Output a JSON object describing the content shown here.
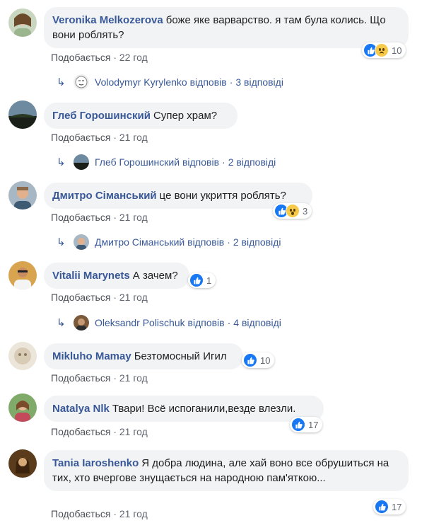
{
  "comments": [
    {
      "author": "Veronika Melkozerova",
      "text": "боже яке варварство. я там була колись. Що вони роблять?",
      "like_label": "Подобається",
      "time": "22 год",
      "reaction_count": "10",
      "reactions": [
        "like-icon",
        "sad-icon"
      ],
      "reply": {
        "author": "Volodymyr Kyrylenko",
        "verb": "відповів",
        "count": "3 відповіді"
      }
    },
    {
      "author": "Глеб Горошинский",
      "text": "Супер храм?",
      "like_label": "Подобається",
      "time": "21 год",
      "reply": {
        "author": "Глеб Горошинский",
        "verb": "відповів",
        "count": "2 відповіді"
      }
    },
    {
      "author": "Дмитро Сіманський",
      "text": "це вони укриття роблять?",
      "like_label": "Подобається",
      "time": "21 год",
      "reaction_count": "3",
      "reactions": [
        "like-icon",
        "wow-icon"
      ],
      "reply": {
        "author": "Дмитро Сіманський",
        "verb": "відповів",
        "count": "2 відповіді"
      }
    },
    {
      "author": "Vitalii Marynets",
      "text": "А зачем?",
      "like_label": "Подобається",
      "time": "21 год",
      "reaction_count": "1",
      "reactions": [
        "like-icon"
      ],
      "reply": {
        "author": "Oleksandr Polischuk",
        "verb": "відповів",
        "count": "4 відповіді"
      }
    },
    {
      "author": "Mikluho Mamay",
      "text": "Безтомосный Игил",
      "like_label": "Подобається",
      "time": "21 год",
      "reaction_count": "10",
      "reactions": [
        "like-icon"
      ]
    },
    {
      "author": "Natalya Nlk",
      "text": "Твари! Всё испоганили,везде влезли.",
      "like_label": "Подобається",
      "time": "21 год",
      "reaction_count": "17",
      "reactions": [
        "like-icon"
      ]
    },
    {
      "author": "Tania Iaroshenko",
      "text": "Я добра людина, але хай воно все обрушиться на тих, хто вчергове знущається на народною пам'яткою...",
      "like_label": "Подобається",
      "time": "21 год",
      "reaction_count": "17",
      "reactions": [
        "like-icon"
      ]
    }
  ],
  "separator": "·",
  "colors": {
    "author": "#385898",
    "bubble": "#f2f3f5",
    "like_blue": "#1877f2",
    "meta": "#606770"
  }
}
